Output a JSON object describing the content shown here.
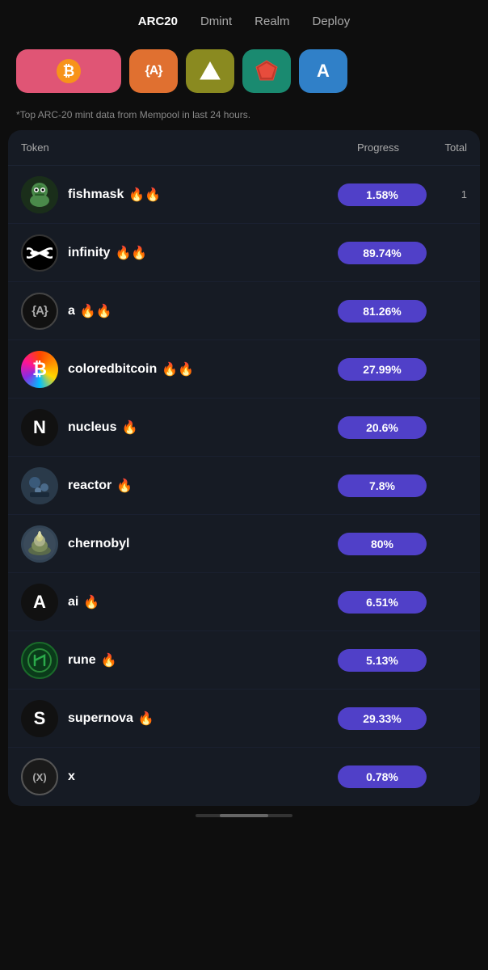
{
  "nav": {
    "items": [
      {
        "label": "ARC20",
        "active": true
      },
      {
        "label": "Dmint",
        "active": false
      },
      {
        "label": "Realm",
        "active": false
      },
      {
        "label": "Deploy",
        "active": false
      }
    ]
  },
  "icon_row": {
    "buttons": [
      {
        "id": "bitcoin-icon-btn",
        "style": "pink",
        "symbol": "₿",
        "label": "bitcoin button"
      },
      {
        "id": "a-bracket-btn",
        "style": "orange",
        "symbol": "{A}",
        "label": "atom button"
      },
      {
        "id": "triangle-btn",
        "style": "olive",
        "symbol": "△",
        "label": "triangle button"
      },
      {
        "id": "gem-btn",
        "style": "teal",
        "symbol": "💎",
        "label": "gem button"
      },
      {
        "id": "a-btn",
        "style": "blue",
        "symbol": "A",
        "label": "A button"
      }
    ]
  },
  "subtitle": "*Top ARC-20 mint data from Mempool in last 24 hours.",
  "table": {
    "headers": {
      "token": "Token",
      "progress": "Progress",
      "total": "Total"
    },
    "rows": [
      {
        "id": "fishmask",
        "name": "fishmask",
        "fires": 2,
        "progress": "1.58%",
        "total": "1",
        "avatar_type": "image",
        "avatar_bg": "#1a3a1a",
        "avatar_text": "🐸"
      },
      {
        "id": "infinity",
        "name": "infinity",
        "fires": 2,
        "progress": "89.74%",
        "total": "",
        "avatar_type": "infinity",
        "avatar_bg": "#000000",
        "avatar_text": "∞"
      },
      {
        "id": "a",
        "name": "a",
        "fires": 2,
        "progress": "81.26%",
        "total": "",
        "avatar_type": "bracket",
        "avatar_bg": "#111111",
        "avatar_text": "{A}"
      },
      {
        "id": "coloredbitcoin",
        "name": "coloredbitcoin",
        "fires": 2,
        "progress": "27.99%",
        "total": "",
        "avatar_type": "bitcoin",
        "avatar_bg": "gradient",
        "avatar_text": "₿"
      },
      {
        "id": "nucleus",
        "name": "nucleus",
        "fires": 1,
        "progress": "20.6%",
        "total": "",
        "avatar_type": "letter",
        "avatar_bg": "#111111",
        "avatar_text": "N"
      },
      {
        "id": "reactor",
        "name": "reactor",
        "fires": 1,
        "progress": "7.8%",
        "total": "",
        "avatar_type": "image",
        "avatar_bg": "#334455",
        "avatar_text": "⚛"
      },
      {
        "id": "chernobyl",
        "name": "chernobyl",
        "fires": 0,
        "progress": "80%",
        "total": "",
        "avatar_type": "image",
        "avatar_bg": "#556677",
        "avatar_text": "🌋"
      },
      {
        "id": "ai",
        "name": "ai",
        "fires": 1,
        "progress": "6.51%",
        "total": "",
        "avatar_type": "letter",
        "avatar_bg": "#111111",
        "avatar_text": "A"
      },
      {
        "id": "rune",
        "name": "rune",
        "fires": 1,
        "progress": "5.13%",
        "total": "",
        "avatar_type": "rune",
        "avatar_bg": "#0a3a1a",
        "avatar_text": "ᚱ"
      },
      {
        "id": "supernova",
        "name": "supernova",
        "fires": 1,
        "progress": "29.33%",
        "total": "",
        "avatar_type": "letter",
        "avatar_bg": "#111111",
        "avatar_text": "S"
      },
      {
        "id": "x",
        "name": "x",
        "fires": 0,
        "progress": "0.78%",
        "total": "",
        "avatar_type": "x",
        "avatar_bg": "#1a1a1a",
        "avatar_text": "(X)"
      }
    ]
  }
}
